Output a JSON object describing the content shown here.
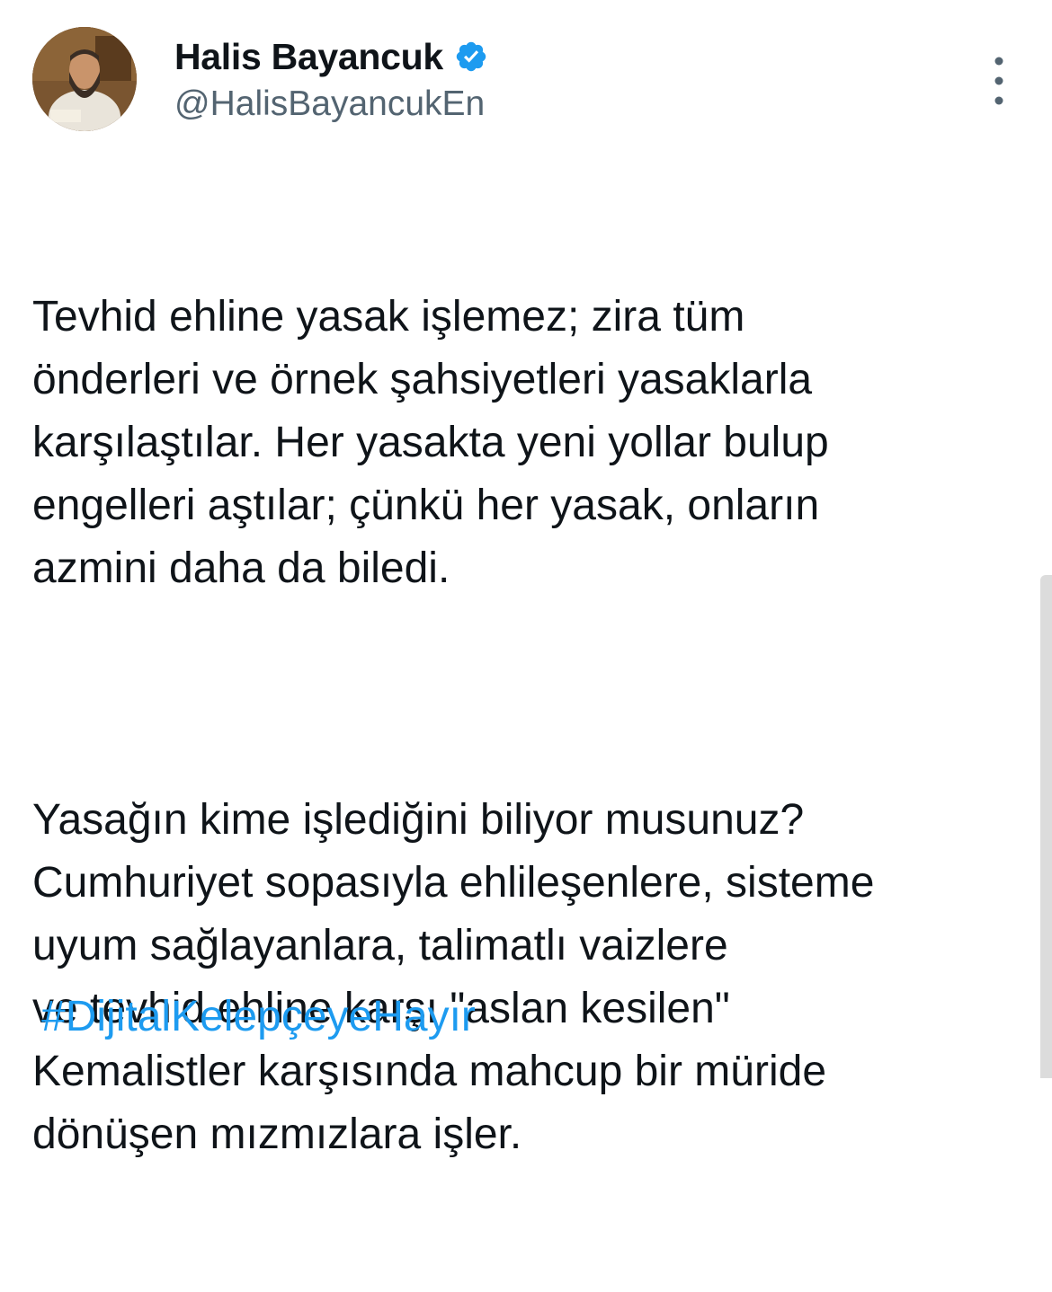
{
  "author": {
    "display_name": "Halis Bayancuk",
    "handle": "@HalisBayancukEn",
    "verified": true
  },
  "post": {
    "paragraph_1": "Tevhid ehline yasak işlemez; zira tüm\nönderleri ve örnek şahsiyetleri yasaklarla\nkarşılaştılar. Her yasakta yeni yollar bulup\nengelleri aştılar; çünkü her yasak, onların\nazmini daha da biledi.",
    "paragraph_2": "Yasağın kime işlediğini biliyor musunuz?\nCumhuriyet sopasıyla ehlileşenlere, sisteme\nuyum sağlayanlara, talimatlı vaizlere\nve tevhid ehline karşı \"aslan kesilen\"\nKemalistler karşısında mahcup bir müride\ndönüşen mızmızlara işler.",
    "hashtag": "#DijitalKelepçeyeHayır"
  },
  "colors": {
    "text": "#0f1419",
    "secondary": "#536471",
    "link": "#1d9bf0",
    "verified": "#1d9bf0"
  },
  "icons": {
    "verified": "verified-badge-icon",
    "more": "more-vertical-icon"
  }
}
